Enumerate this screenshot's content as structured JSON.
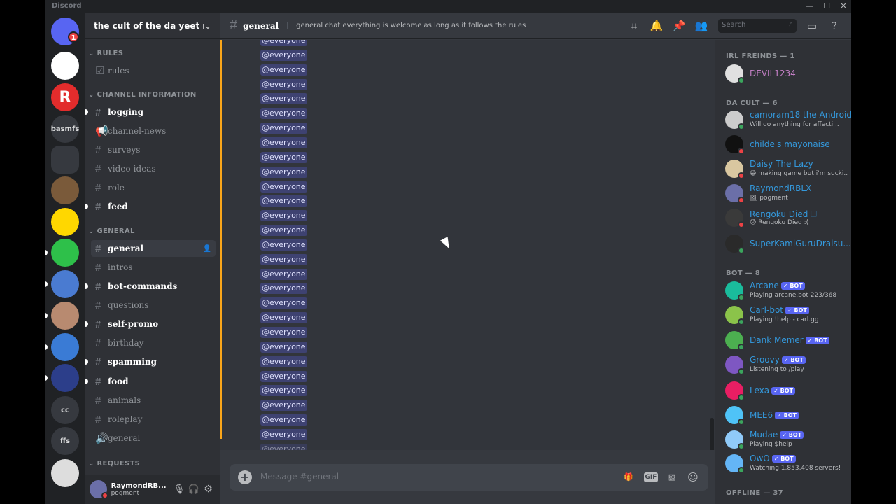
{
  "window": {
    "app_name": "Discord"
  },
  "server": {
    "name": "the cult of the da yeet m...",
    "guilds": [
      {
        "label": "",
        "color": "#5865f2"
      },
      {
        "label": "",
        "color": "#ffffff"
      },
      {
        "label": "R",
        "color": "#e22c2c"
      },
      {
        "label": "basmfs",
        "color": "#36393f"
      },
      {
        "label": "",
        "color": "#36393f"
      },
      {
        "label": "",
        "color": "#7a5a3a"
      },
      {
        "label": "",
        "color": "#ffd700"
      },
      {
        "label": "",
        "color": "#2ec04a"
      },
      {
        "label": "",
        "color": "#4a7bd1"
      },
      {
        "label": "",
        "color": "#b88a70"
      },
      {
        "label": "",
        "color": "#3a7bd5"
      },
      {
        "label": "",
        "color": "#2c3e8a"
      },
      {
        "label": "cc",
        "color": "#36393f"
      },
      {
        "label": "ffs",
        "color": "#36393f"
      },
      {
        "label": "",
        "color": "#dddddd"
      }
    ],
    "guild_badge": "1"
  },
  "categories": {
    "rules": "RULES",
    "channel_information": "CHANNEL INFORMATION",
    "general": "GENERAL",
    "requests": "REQUESTS"
  },
  "channels": {
    "rules": "rules",
    "logging": "logging",
    "channel_news": "channel-news",
    "surveys": "surveys",
    "video_ideas": "video-ideas",
    "role": "role",
    "feed": "feed",
    "general": "general",
    "intros": "intros",
    "bot_commands": "bot-commands",
    "questions": "questions",
    "self_promo": "self-promo",
    "birthday": "birthday",
    "spamming": "spamming",
    "food": "food",
    "animals": "animals",
    "roleplay": "roleplay",
    "general_voice": "general"
  },
  "user_panel": {
    "name": "RaymondRB...",
    "status": "pogment"
  },
  "topbar": {
    "channel": "general",
    "topic": "general chat everything is welcome as long as it follows the rules",
    "search_placeholder": "Search"
  },
  "messages": {
    "mention_text": "@everyone",
    "count": 29
  },
  "composer": {
    "placeholder": "Message #general",
    "gif_label": "GIF"
  },
  "members": {
    "irl_header": "IRL FREINDS — 1",
    "cult_header": "DA CULT — 6",
    "bot_header": "BOT — 8",
    "offline_header": "OFFLINE — 37",
    "bot_tag": "✓ BOT",
    "irl": [
      {
        "name": "DEVIL1234",
        "activity": "",
        "color": "#c27ec4",
        "status": "#3ba55d",
        "avatar": "#e0e0e0"
      }
    ],
    "cult": [
      {
        "name": "camoram18 the Android",
        "activity": "Will do anything for affecti...",
        "color": "#3498db",
        "status": "#3ba55d",
        "avatar": "#cccccc"
      },
      {
        "name": "childe's mayonaise",
        "activity": "",
        "color": "#3498db",
        "status": "#ed4245",
        "avatar": "#111111"
      },
      {
        "name": "Daisy The Lazy",
        "activity": "😁 making game but i'm sucki...",
        "color": "#3498db",
        "status": "#ed4245",
        "avatar": "#d9c7a0"
      },
      {
        "name": "RaymondRBLX",
        "activity": "🖼 pogment",
        "color": "#3498db",
        "status": "#ed4245",
        "avatar": "#6b6fa8"
      },
      {
        "name": "Rengoku Died 🗆",
        "activity": "😞 Rengoku Died :(",
        "color": "#3498db",
        "status": "#ed4245",
        "avatar": "#3a3a3a"
      },
      {
        "name": "SuperKamiGuruDraisu...",
        "activity": "",
        "color": "#3498db",
        "status": "#3ba55d",
        "avatar": "#2a2a2a"
      }
    ],
    "bots": [
      {
        "name": "Arcane",
        "activity": "Playing arcane.bot 223/368",
        "color": "#3498db",
        "status": "#3ba55d",
        "avatar": "#1abc9c"
      },
      {
        "name": "Carl-bot",
        "activity": "Playing !help - carl.gg",
        "color": "#3498db",
        "status": "#3ba55d",
        "avatar": "#8bc34a"
      },
      {
        "name": "Dank Memer",
        "activity": "",
        "color": "#3498db",
        "status": "#3ba55d",
        "avatar": "#4caf50"
      },
      {
        "name": "Groovy",
        "activity": "Listening to /play",
        "color": "#3498db",
        "status": "#3ba55d",
        "avatar": "#7e57c2"
      },
      {
        "name": "Lexa",
        "activity": "",
        "color": "#3498db",
        "status": "#3ba55d",
        "avatar": "#e91e63"
      },
      {
        "name": "MEE6",
        "activity": "",
        "color": "#3498db",
        "status": "#3ba55d",
        "avatar": "#4fc3f7"
      },
      {
        "name": "Mudae",
        "activity": "Playing $help",
        "color": "#3498db",
        "status": "#3ba55d",
        "avatar": "#90caf9"
      },
      {
        "name": "OwO",
        "activity": "Watching 1,853,408 servers!",
        "color": "#3498db",
        "status": "#3ba55d",
        "avatar": "#64b5f6"
      }
    ]
  }
}
